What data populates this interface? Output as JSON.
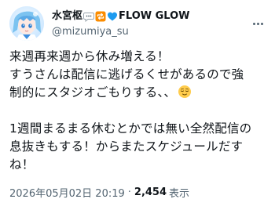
{
  "author": {
    "name": "水宮枢",
    "name_suffix": "FLOW GLOW",
    "handle": "@mizumiya_su"
  },
  "tweet": {
    "lines": [
      "来週再来週から休み増える！",
      "すうさんは配信に逃げるくせがあるので強",
      "制的にスタジオごもりする、、",
      "1週間まるまる休むとかでは無い全然配信の",
      "息抜きもする！からまたスケジュールだす",
      "ね！"
    ]
  },
  "meta": {
    "timestamp": "2026年05月02日 20:19",
    "separator": "·",
    "views_count": "2,454",
    "views_label": "表示"
  },
  "icons": {
    "speech": "speech-bubble-icon",
    "repeat": "repeat-icon",
    "heart": "blue-heart-icon",
    "relieved": "relieved-face-icon",
    "more": "more-options-icon"
  },
  "colors": {
    "text": "#0f1419",
    "secondary": "#536471",
    "heart": "#1d9bf0",
    "repeat_bg": "#fb8c00"
  }
}
